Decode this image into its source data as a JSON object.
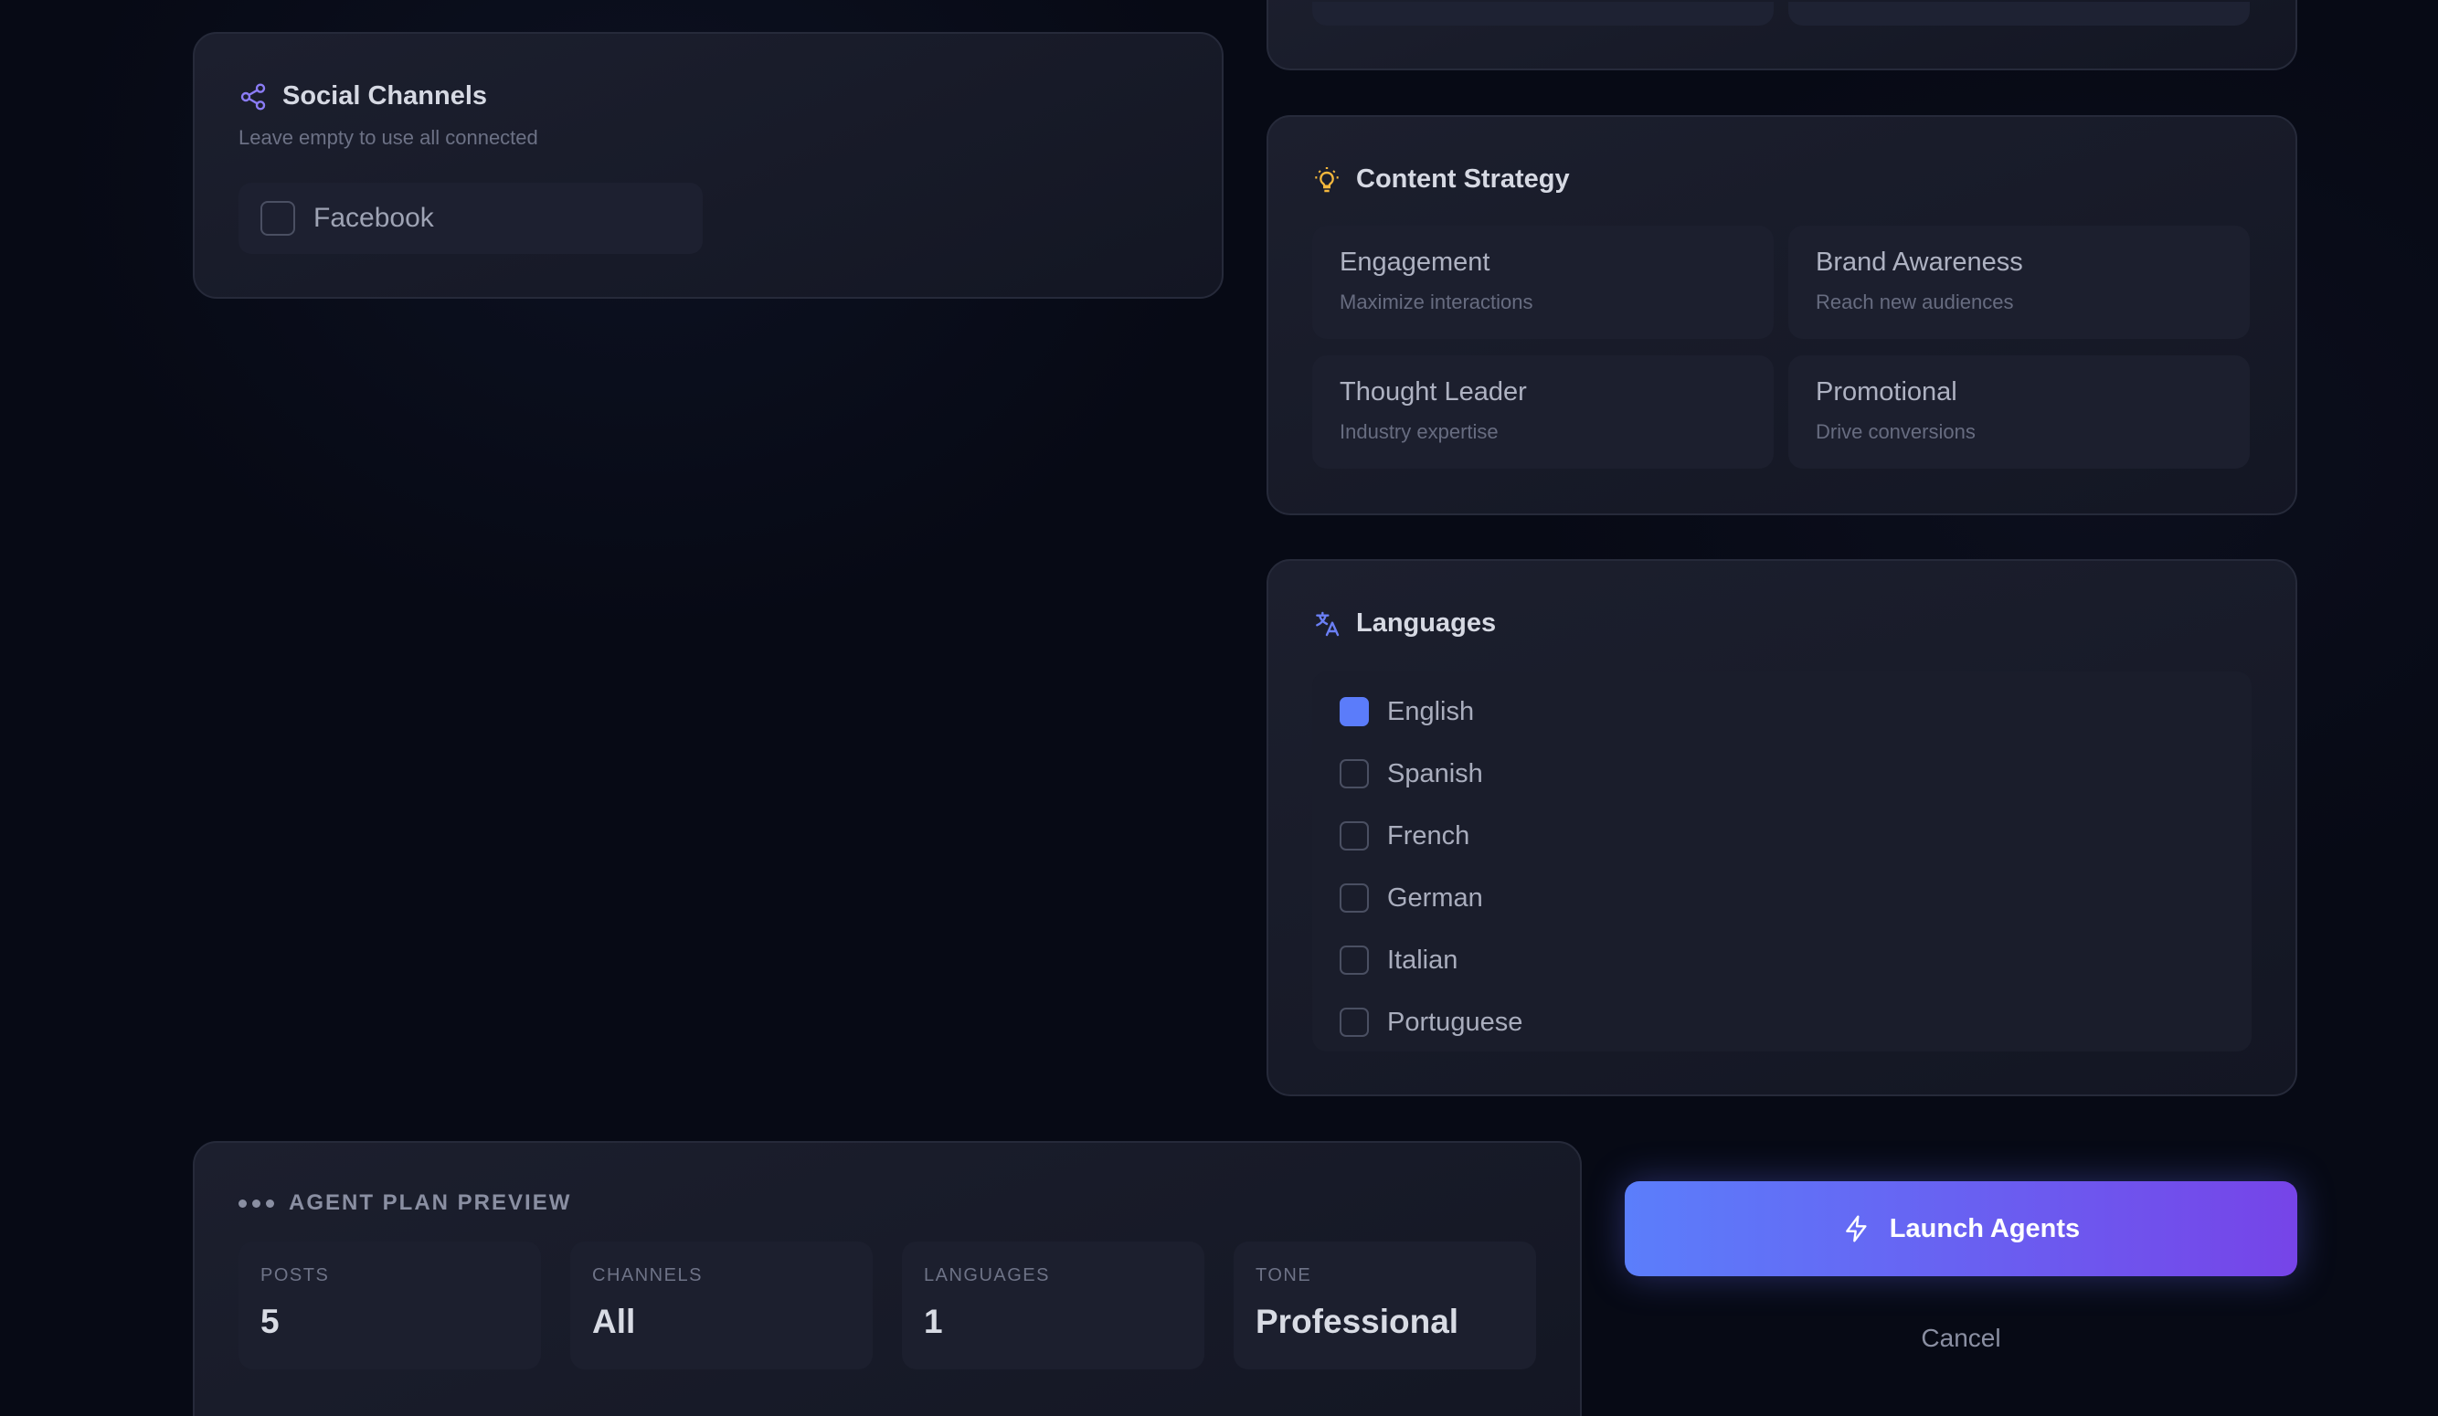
{
  "social_channels": {
    "title": "Social Channels",
    "subtitle": "Leave empty to use all connected",
    "options": [
      {
        "label": "Facebook",
        "checked": false
      }
    ]
  },
  "content_strategy": {
    "title": "Content Strategy",
    "options": [
      {
        "title": "Engagement",
        "description": "Maximize interactions"
      },
      {
        "title": "Brand Awareness",
        "description": "Reach new audiences"
      },
      {
        "title": "Thought Leader",
        "description": "Industry expertise"
      },
      {
        "title": "Promotional",
        "description": "Drive conversions"
      }
    ]
  },
  "languages": {
    "title": "Languages",
    "items": [
      {
        "label": "English",
        "checked": true
      },
      {
        "label": "Spanish",
        "checked": false
      },
      {
        "label": "French",
        "checked": false
      },
      {
        "label": "German",
        "checked": false
      },
      {
        "label": "Italian",
        "checked": false
      },
      {
        "label": "Portuguese",
        "checked": false
      }
    ]
  },
  "preview": {
    "title": "AGENT PLAN PREVIEW",
    "stats": [
      {
        "label": "POSTS",
        "value": "5"
      },
      {
        "label": "CHANNELS",
        "value": "All"
      },
      {
        "label": "LANGUAGES",
        "value": "1"
      },
      {
        "label": "TONE",
        "value": "Professional"
      }
    ]
  },
  "actions": {
    "launch_label": "Launch Agents",
    "cancel_label": "Cancel"
  },
  "colors": {
    "accent": "#5b7cfa",
    "gradient_start": "#5b7efb",
    "gradient_end": "#7644e8",
    "share_icon": "#8b7cf6",
    "bulb_icon": "#f5b83d",
    "translate_icon": "#6b7ff5"
  },
  "icons": {
    "social": "share-icon",
    "strategy": "lightbulb-icon",
    "languages": "translate-icon",
    "preview": "dots-icon",
    "launch": "lightning-icon"
  }
}
